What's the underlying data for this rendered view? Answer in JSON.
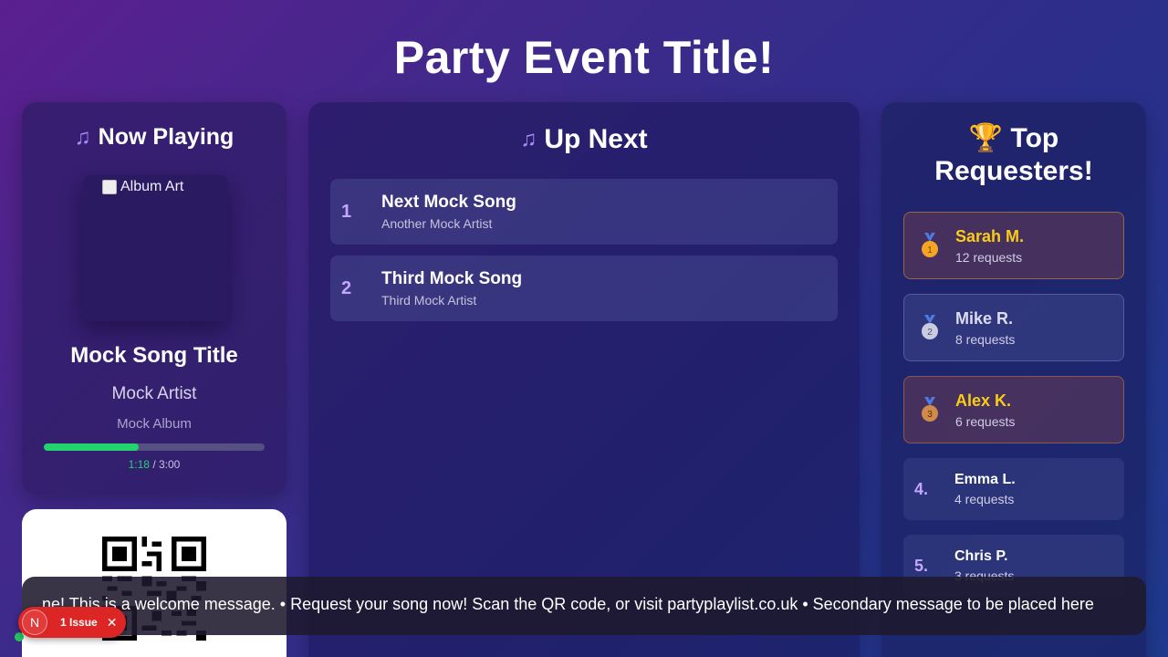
{
  "event_title": "Party Event Title!",
  "now_playing": {
    "heading": "Now Playing",
    "heading_icon": "music-note-icon",
    "album_art_alt": "Album Art",
    "song_title": "Mock Song Title",
    "artist": "Mock Artist",
    "album": "Mock Album",
    "elapsed": "1:18",
    "duration": "/ 3:00",
    "progress": 0.43
  },
  "up_next": {
    "heading": "Up Next",
    "heading_icon": "music-notes-icon",
    "items": [
      {
        "num": "1",
        "title": "Next Mock Song",
        "artist": "Another Mock Artist"
      },
      {
        "num": "2",
        "title": "Third Mock Song",
        "artist": "Third Mock Artist"
      }
    ]
  },
  "top_requesters": {
    "heading_line1": "🏆 Top",
    "heading_line2": "Requesters!",
    "items": [
      {
        "medal": "1",
        "name": "Sarah M.",
        "count": "12 requests"
      },
      {
        "medal": "2",
        "name": "Mike R.",
        "count": "8 requests"
      },
      {
        "medal": "3",
        "name": "Alex K.",
        "count": "6 requests"
      },
      {
        "rank": "4.",
        "name": "Emma L.",
        "count": "4 requests"
      },
      {
        "rank": "5.",
        "name": "Chris P.",
        "count": "3 requests"
      }
    ]
  },
  "ticker": {
    "text": "ne! This is a welcome message. • Request your song now! Scan the QR code, or visit partyplaylist.co.uk • Secondary message to be placed here"
  },
  "issue_badge": {
    "logo": "N",
    "label": "1 Issue",
    "close": "✕"
  },
  "colors": {
    "accent": "#c4a6ff",
    "progress": "#22d36e",
    "gold": "#facc15",
    "issue": "#dc2626"
  }
}
